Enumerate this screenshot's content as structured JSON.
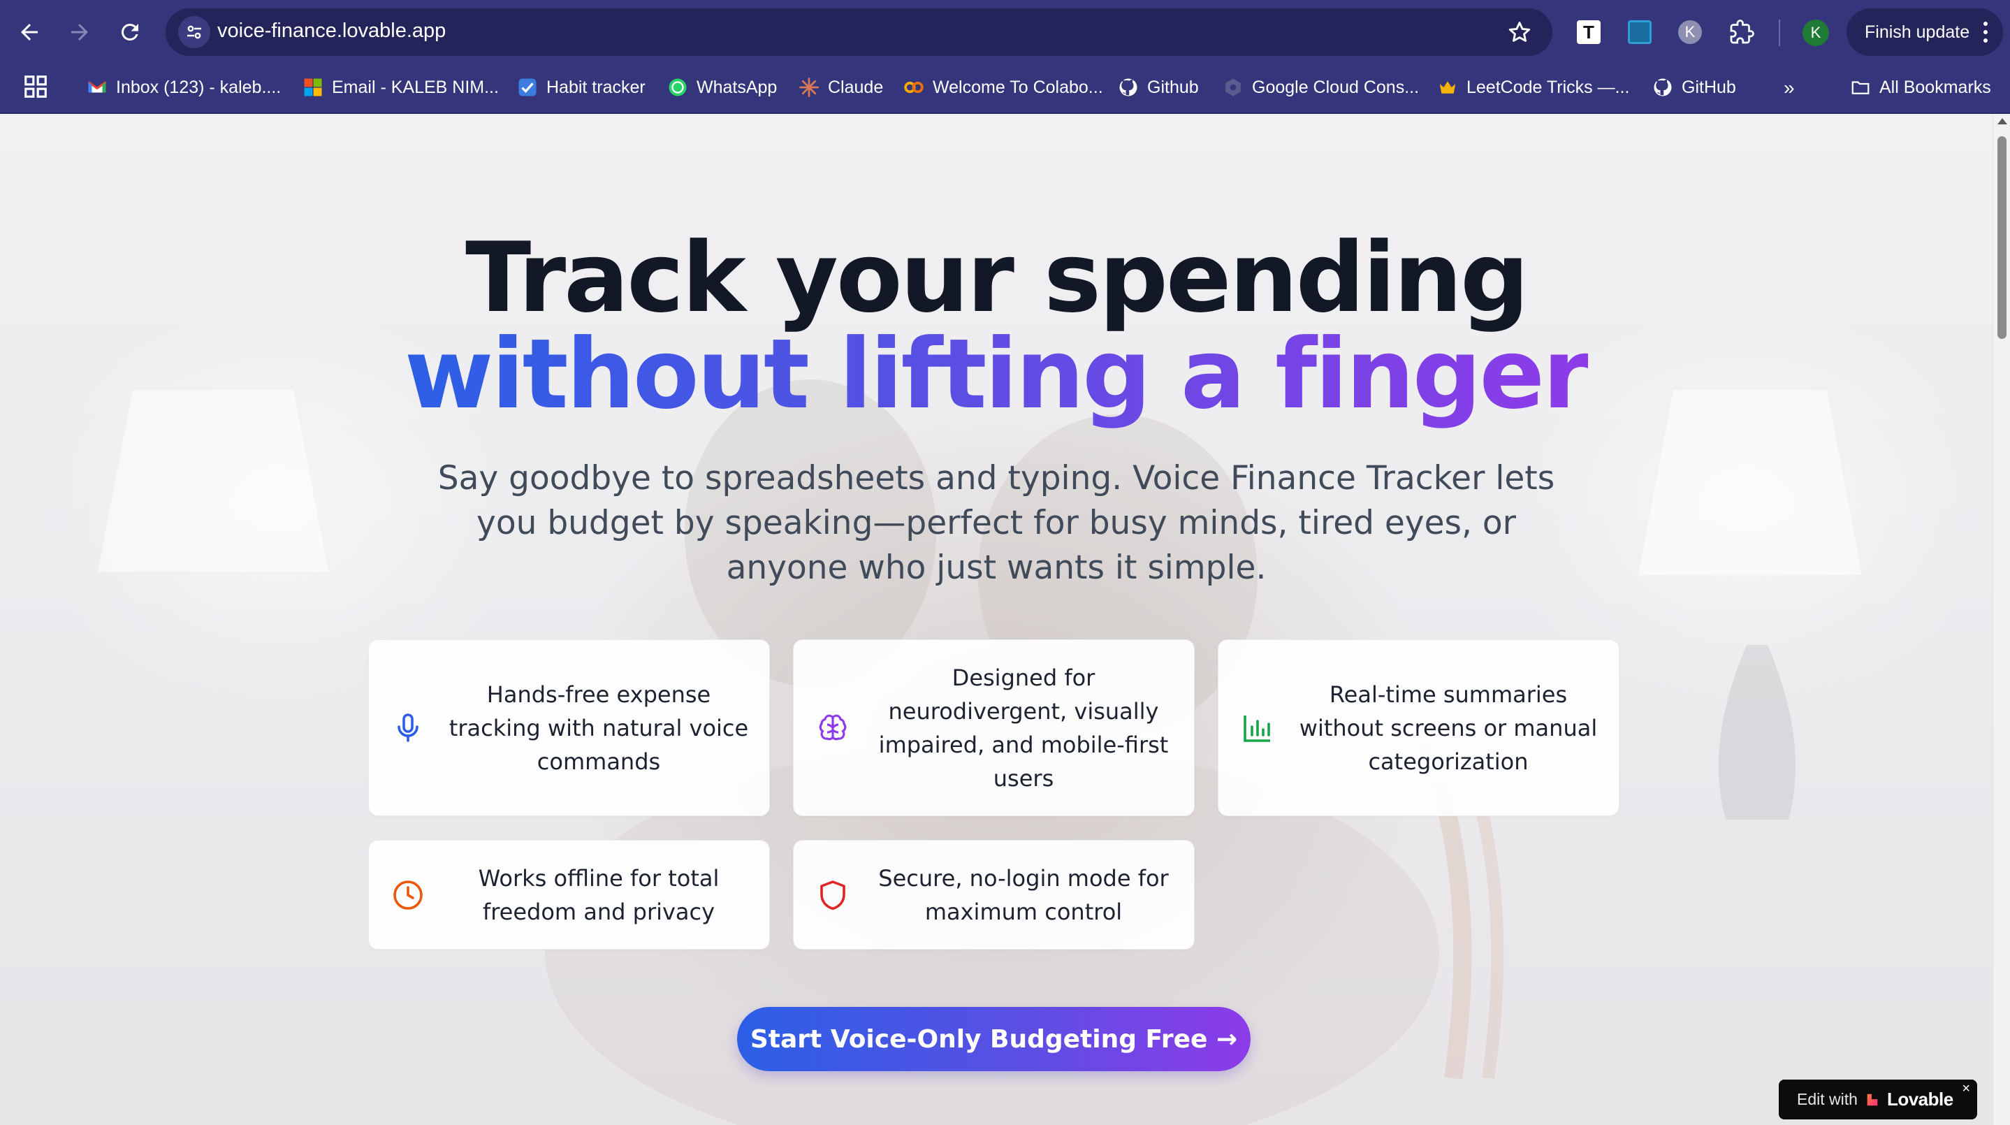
{
  "browser": {
    "url": "voice-finance.lovable.app",
    "finish_update_label": "Finish update",
    "profile_initial": "K",
    "extension_t": "T",
    "extension_k": "K",
    "bookmarks": [
      {
        "label": "Inbox (123) - kaleb....",
        "icon": "gmail-icon"
      },
      {
        "label": "Email - KALEB NIM...",
        "icon": "microsoft-icon"
      },
      {
        "label": "Habit tracker",
        "icon": "checkmark-icon"
      },
      {
        "label": "WhatsApp",
        "icon": "whatsapp-icon"
      },
      {
        "label": "Claude",
        "icon": "claude-icon"
      },
      {
        "label": "Welcome To Colabo...",
        "icon": "colab-icon"
      },
      {
        "label": "Github",
        "icon": "github-icon"
      },
      {
        "label": "Google Cloud Cons...",
        "icon": "google-cloud-icon"
      },
      {
        "label": "LeetCode Tricks —...",
        "icon": "crown-icon"
      },
      {
        "label": "GitHub",
        "icon": "github-icon"
      }
    ],
    "overflow_label": "»",
    "all_bookmarks_label": "All Bookmarks"
  },
  "hero": {
    "title_line1": "Track your spending",
    "title_line2": "without lifting a finger",
    "subtitle": "Say goodbye to spreadsheets and typing. Voice Finance Tracker lets you budget by speaking—perfect for busy minds, tired eyes, or anyone who just wants it simple."
  },
  "features": [
    {
      "text": "Hands-free expense tracking with natural voice commands",
      "icon": "microphone-icon",
      "color": "#2c5fe6"
    },
    {
      "text": "Designed for neurodivergent, visually impaired, and mobile-first users",
      "icon": "brain-icon",
      "color": "#8d3be8"
    },
    {
      "text": "Real-time summaries without screens or manual categorization",
      "icon": "bar-chart-icon",
      "color": "#16a34a"
    },
    {
      "text": "Works offline for total freedom and privacy",
      "icon": "clock-icon",
      "color": "#ea580c"
    },
    {
      "text": "Secure, no-login mode for maximum control",
      "icon": "shield-icon",
      "color": "#dc2626"
    }
  ],
  "cta": {
    "label": "Start Voice-Only Budgeting Free →"
  },
  "lovable_badge": {
    "edit_label": "Edit with",
    "brand": "Lovable",
    "close": "×"
  },
  "colors": {
    "chrome": "#34357a",
    "omnibox": "#23245a",
    "title": "#121826",
    "gradient_start": "#2c5fe6",
    "gradient_end": "#8d3be8"
  }
}
